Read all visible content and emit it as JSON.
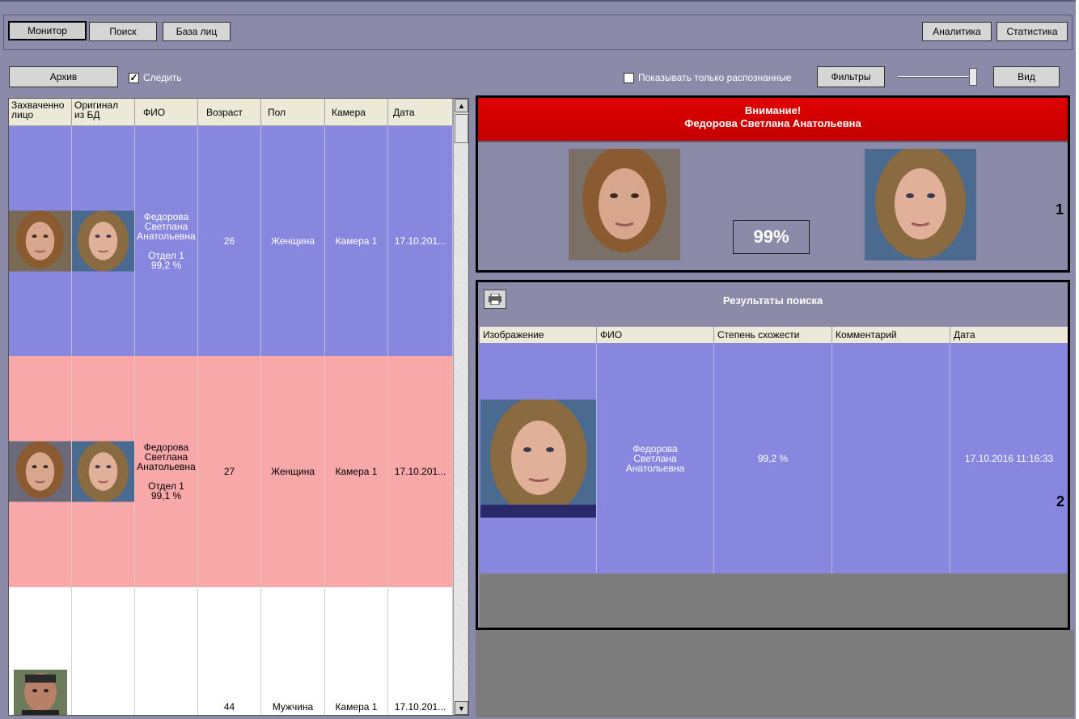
{
  "toolbar": {
    "monitor": "Монитор",
    "search": "Поиск",
    "face_db": "База лиц",
    "analytics": "Аналитика",
    "statistics": "Статистика"
  },
  "controls": {
    "archive": "Архив",
    "follow_label": "Следить",
    "follow_checked": true,
    "only_recognized_label": "Показывать только распознанные",
    "only_recognized_checked": false,
    "filters": "Фильтры",
    "view": "Вид",
    "slider_value_fraction": 0.95
  },
  "left_table": {
    "columns": [
      "Захваченно лицо",
      "Оригинал из БД",
      "ФИО",
      "Возраст",
      "Пол",
      "Камера",
      "Дата"
    ],
    "col_captured_1": "Захваченно",
    "col_captured_2": "лицо",
    "col_original_1": "Оригинал",
    "col_original_2": "из БД",
    "rows": [
      {
        "fio_1": "Федорова",
        "fio_2": "Светлана",
        "fio_3": "Анатольевна",
        "dept": "Отдел 1",
        "score": "99,2 %",
        "age": "26",
        "sex": "Женщина",
        "camera": "Камера 1",
        "date": "17.10.201..."
      },
      {
        "fio_1": "Федорова",
        "fio_2": "Светлана",
        "fio_3": "Анатольевна",
        "dept": "Отдел 1",
        "score": "99,1 %",
        "age": "27",
        "sex": "Женщина",
        "camera": "Камера 1",
        "date": "17.10.201..."
      },
      {
        "age": "44",
        "sex": "Мужчина",
        "camera": "Камера 1",
        "date": "17.10.201..."
      }
    ]
  },
  "alert": {
    "line1": "Внимание!",
    "line2": "Федорова Светлана Анатольевна",
    "match_percent": "99%",
    "marker": "1"
  },
  "results": {
    "title": "Результаты поиска",
    "marker": "2",
    "columns": [
      "Изображение",
      "ФИО",
      "Степень схожести",
      "Комментарий",
      "Дата"
    ],
    "row": {
      "fio_1": "Федорова",
      "fio_2": "Светлана",
      "fio_3": "Анатольевна",
      "similarity": "99,2 %",
      "comment": "",
      "date": "17.10.2016 11:16:33"
    }
  },
  "colors": {
    "row_blue": "#8887e0",
    "row_pink": "#f9a8aa",
    "alert_red": "#d40000",
    "panel_bg": "#8b8aa8"
  }
}
